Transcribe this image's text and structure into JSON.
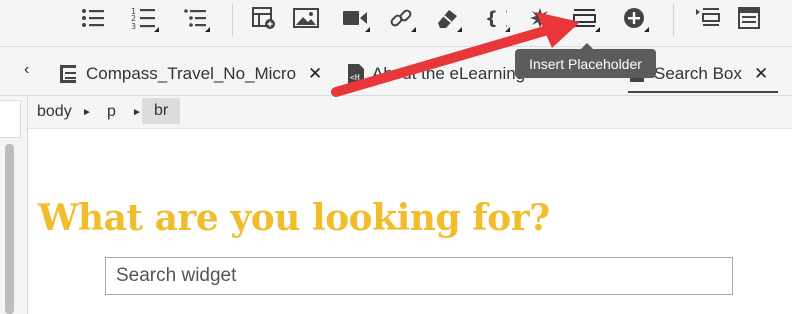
{
  "toolbar": {
    "buttons": [
      {
        "name": "bullet-list-icon"
      },
      {
        "name": "numbered-list-icon"
      },
      {
        "name": "indent-list-icon"
      },
      {
        "name": "insert-table-icon"
      },
      {
        "name": "insert-image-icon"
      },
      {
        "name": "insert-video-icon"
      },
      {
        "name": "insert-link-icon"
      },
      {
        "name": "insert-snippet-icon"
      },
      {
        "name": "insert-variable-icon"
      },
      {
        "name": "insert-special-icon"
      },
      {
        "name": "insert-placeholder-icon"
      },
      {
        "name": "insert-more-icon"
      },
      {
        "name": "topic-toc-icon"
      },
      {
        "name": "topic-layout-icon"
      }
    ],
    "tooltip": "Insert Placeholder"
  },
  "tabs": [
    {
      "label": "Compass_Travel_No_Micro",
      "close": "✕"
    },
    {
      "label": "About the eLearning",
      "close": "✕"
    },
    {
      "label": "Search Box",
      "close": "✕"
    }
  ],
  "tabs_scroll_left": "‹",
  "breadcrumb": {
    "items": [
      "body",
      "p",
      "br"
    ],
    "separator": "►"
  },
  "content": {
    "heading": "What are you looking for?",
    "search_text": "Search widget"
  },
  "colors": {
    "heading": "#f2bd2c",
    "annotation_arrow": "#e8363a"
  }
}
